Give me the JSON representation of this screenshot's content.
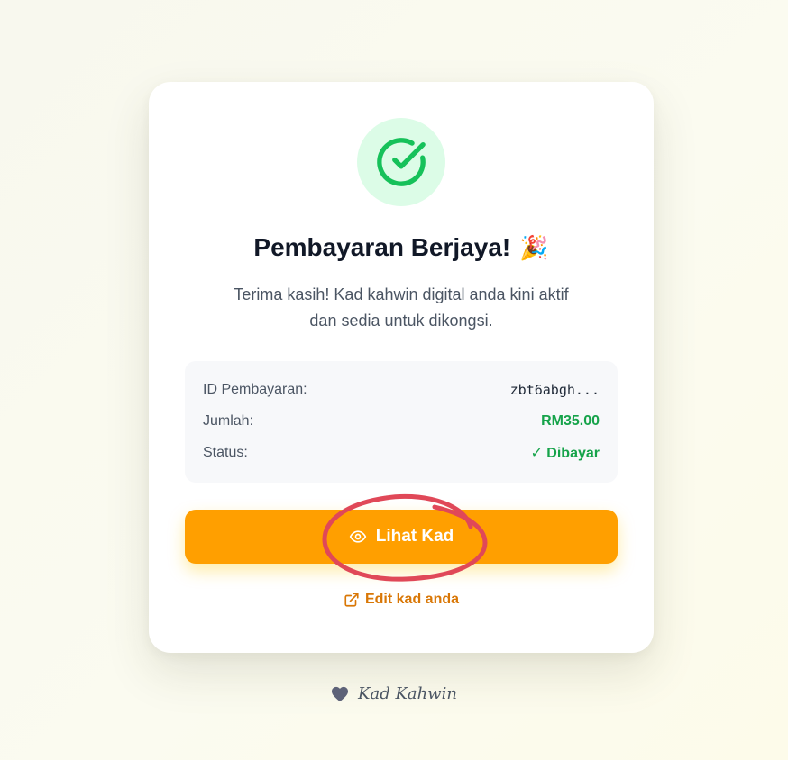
{
  "success": {
    "title": "Pembayaran Berjaya!",
    "celebration_emoji": "🎉",
    "message_line1": "Terima kasih! Kad kahwin digital anda kini aktif",
    "message_line2": "dan sedia untuk dikongsi."
  },
  "payment": {
    "id_label": "ID Pembayaran:",
    "id_value": "zbt6abgh...",
    "amount_label": "Jumlah:",
    "amount_value": "RM35.00",
    "status_label": "Status:",
    "status_value": "✓ Dibayar"
  },
  "actions": {
    "view_card_label": "Lihat Kad",
    "edit_card_label": "Edit kad anda"
  },
  "footer": {
    "brand": "Kad Kahwin"
  },
  "colors": {
    "primary": "#ff9f00",
    "success": "#16a34a",
    "success_bg": "#dcfce7",
    "link": "#d97706",
    "annotation": "#e04858"
  }
}
